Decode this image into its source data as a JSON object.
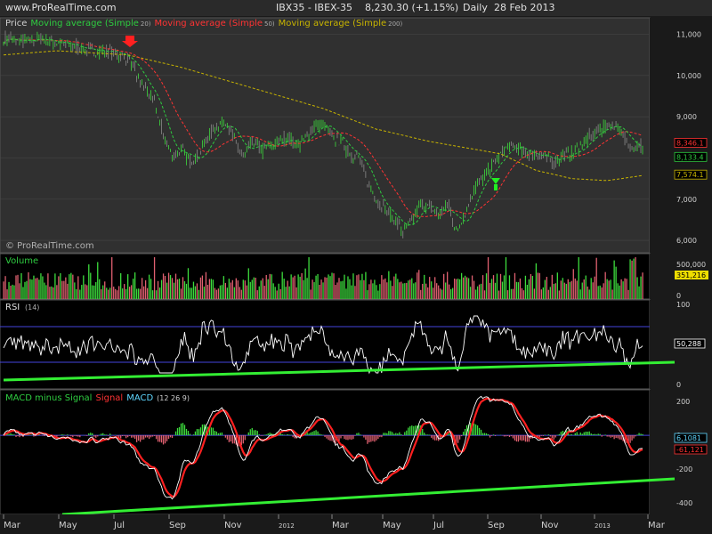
{
  "header": {
    "url": "www.ProRealTime.com",
    "title": "IBX35 - IBEX-35",
    "price": "8,230.30 (+1.15%)",
    "period": "Daily",
    "date": "28 Feb 2013"
  },
  "price_panel": {
    "legend": [
      {
        "text": "Price",
        "color": "#d0d0d0"
      },
      {
        "text": "Moving average (Simple",
        "color": "#2ecc40",
        "param": "20)"
      },
      {
        "text": "Moving average (Simple",
        "color": "#ff3333",
        "param": "50)"
      },
      {
        "text": "Moving average (Simple",
        "color": "#c8b400",
        "param": "200)"
      }
    ],
    "watermark": "© ProRealTime.com",
    "y_ticks": [
      "11,000",
      "10,000",
      "9,000",
      "8,000",
      "7,000",
      "6,000"
    ],
    "value_tags": [
      {
        "text": "8,346.1",
        "color": "#ff3333",
        "value": 8346
      },
      {
        "text": "8,133.4",
        "color": "#2ecc40",
        "value": 8133
      },
      {
        "text": "7,574.1",
        "color": "#c8b400",
        "value": 7574
      }
    ]
  },
  "volume_panel": {
    "title": "Volume",
    "y_ticks": [
      "500,000",
      "0"
    ],
    "value_tag": "351,216"
  },
  "rsi_panel": {
    "title": "RSI",
    "param": "(14)",
    "y_ticks": [
      "100",
      "50",
      "0"
    ],
    "value_tag": "50,288"
  },
  "macd_panel": {
    "title_parts": [
      {
        "text": "MACD minus Signal",
        "color": "#2ecc40"
      },
      {
        "text": "Signal",
        "color": "#ff3333"
      },
      {
        "text": "MACD",
        "color": "#5fd7ff"
      },
      {
        "text": "(12 26 9)",
        "color": "#d0d0d0"
      }
    ],
    "y_ticks": [
      "200",
      "0",
      "-200",
      "-400"
    ],
    "value_tags": [
      {
        "text": "6,1081",
        "color": "#5fd7ff"
      },
      {
        "text": "-61,121",
        "color": "#ff3333"
      }
    ]
  },
  "x_axis": {
    "labels": [
      "Mar",
      "May",
      "Jul",
      "Sep",
      "Nov",
      "2012",
      "Mar",
      "May",
      "Jul",
      "Sep",
      "Nov",
      "2013",
      "Mar"
    ]
  },
  "annotations": {
    "sell_arrow": "red down arrow",
    "buy_arrow": "green up arrow"
  },
  "chart_data": {
    "type": "line",
    "price_series": {
      "name": "Price",
      "anchors": [
        [
          0,
          10900
        ],
        [
          20,
          10800
        ],
        [
          40,
          10900
        ],
        [
          60,
          10800
        ],
        [
          80,
          10700
        ],
        [
          100,
          10600
        ],
        [
          120,
          10600
        ],
        [
          140,
          10400
        ],
        [
          150,
          9950
        ],
        [
          160,
          9700
        ],
        [
          170,
          9300
        ],
        [
          180,
          8500
        ],
        [
          190,
          8050
        ],
        [
          200,
          8200
        ],
        [
          210,
          7900
        ],
        [
          220,
          8100
        ],
        [
          230,
          8500
        ],
        [
          240,
          8800
        ],
        [
          250,
          8900
        ],
        [
          260,
          8400
        ],
        [
          270,
          8000
        ],
        [
          280,
          8400
        ],
        [
          290,
          8200
        ],
        [
          300,
          8300
        ],
        [
          310,
          8400
        ],
        [
          320,
          8500
        ],
        [
          330,
          8300
        ],
        [
          340,
          8500
        ],
        [
          350,
          8800
        ],
        [
          360,
          8800
        ],
        [
          370,
          8500
        ],
        [
          380,
          8400
        ],
        [
          390,
          8100
        ],
        [
          400,
          8000
        ],
        [
          410,
          7400
        ],
        [
          420,
          7000
        ],
        [
          430,
          6700
        ],
        [
          440,
          6500
        ],
        [
          450,
          6200
        ],
        [
          460,
          6500
        ],
        [
          470,
          6900
        ],
        [
          480,
          6800
        ],
        [
          490,
          6600
        ],
        [
          500,
          6900
        ],
        [
          510,
          6200
        ],
        [
          520,
          6700
        ],
        [
          530,
          7300
        ],
        [
          540,
          7500
        ],
        [
          550,
          7800
        ],
        [
          560,
          8100
        ],
        [
          570,
          8300
        ],
        [
          580,
          8200
        ],
        [
          590,
          8100
        ],
        [
          600,
          8100
        ],
        [
          610,
          8000
        ],
        [
          620,
          7900
        ],
        [
          630,
          8100
        ],
        [
          640,
          8100
        ],
        [
          650,
          8300
        ],
        [
          660,
          8500
        ],
        [
          670,
          8700
        ],
        [
          680,
          8800
        ],
        [
          690,
          8800
        ],
        [
          700,
          8400
        ],
        [
          710,
          8300
        ],
        [
          720,
          8230
        ]
      ]
    },
    "ma200": {
      "name": "Moving average (Simple 200)",
      "anchors": [
        [
          0,
          10500
        ],
        [
          60,
          10600
        ],
        [
          140,
          10500
        ],
        [
          200,
          10200
        ],
        [
          280,
          9700
        ],
        [
          360,
          9200
        ],
        [
          420,
          8700
        ],
        [
          480,
          8400
        ],
        [
          560,
          8100
        ],
        [
          600,
          7700
        ],
        [
          640,
          7500
        ],
        [
          680,
          7450
        ],
        [
          720,
          7574
        ]
      ]
    },
    "volume": {
      "range": [
        0,
        500000
      ],
      "typical": 250000,
      "last": 351216
    },
    "rsi": {
      "range": [
        0,
        100
      ],
      "overbought": 70,
      "oversold": 30,
      "last": 50.288
    },
    "macd": {
      "range": [
        -400,
        200
      ],
      "last_macd": 6.1081,
      "last_signal": -61.121
    },
    "x_labels": [
      "Mar",
      "May",
      "Jul",
      "Sep",
      "Nov",
      "2012",
      "Mar",
      "May",
      "Jul",
      "Sep",
      "Nov",
      "2013",
      "Mar"
    ]
  }
}
